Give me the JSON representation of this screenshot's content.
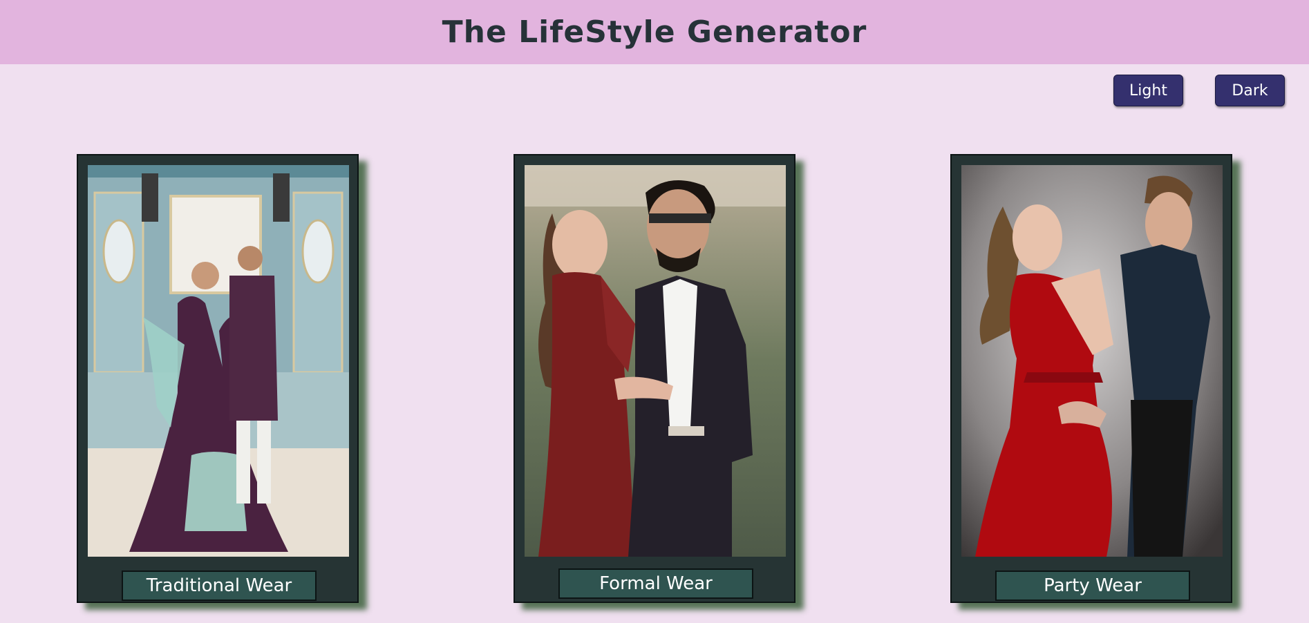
{
  "header": {
    "title": "The LifeStyle Generator"
  },
  "theme_buttons": {
    "light_label": "Light",
    "dark_label": "Dark"
  },
  "cards": [
    {
      "label": "Traditional Wear"
    },
    {
      "label": "Formal Wear"
    },
    {
      "label": "Party Wear"
    }
  ],
  "colors": {
    "page_background": "#f0e0f0",
    "header_background": "#e2b4de",
    "button_background": "#34306e",
    "card_background": "#263434",
    "label_background": "#2f5450"
  }
}
